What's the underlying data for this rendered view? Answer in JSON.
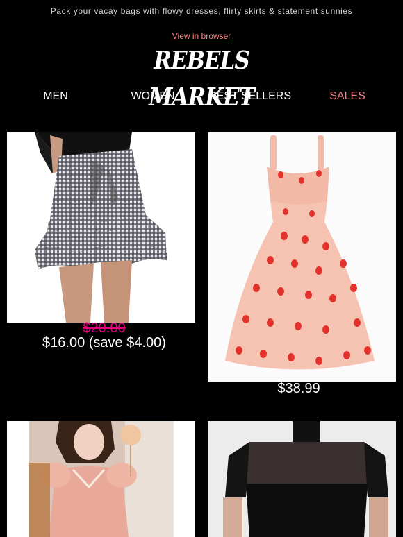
{
  "preheader": "Pack your vacay bags with flowy dresses, flirty skirts & statement sunnies",
  "view_in_browser": "View in browser",
  "brand": {
    "logo_text": "REBELS MARKET"
  },
  "nav": [
    {
      "label": "MEN"
    },
    {
      "label": "WOMEN"
    },
    {
      "label": "BEST SELLERS"
    },
    {
      "label": "SALES"
    }
  ],
  "products": [
    {
      "image": "gingham-ruffle-skirt",
      "old_price": "$20.00",
      "price": "$16.00 (save $4.00)"
    },
    {
      "image": "strawberry-print-dress",
      "price": "$38.99"
    },
    {
      "image": "pink-puff-sleeve-dress"
    },
    {
      "image": "black-mesh-top"
    }
  ],
  "colors": {
    "background": "#000000",
    "accent": "#f0888a",
    "sale_price": "#e6007e"
  }
}
